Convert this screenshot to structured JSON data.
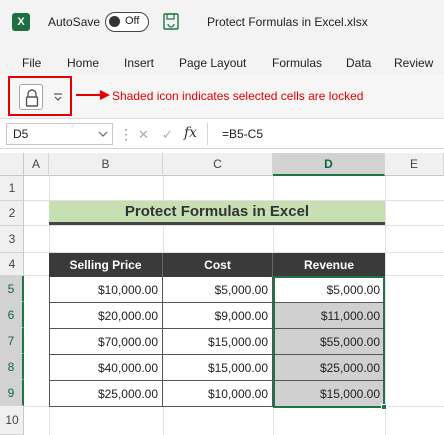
{
  "titlebar": {
    "app_icon_letter": "X",
    "autosave_label": "AutoSave",
    "autosave_state": "Off",
    "document_title": "Protect Formulas in Excel.xlsx"
  },
  "menu": {
    "items": [
      "File",
      "Home",
      "Insert",
      "Page Layout",
      "Formulas",
      "Data",
      "Review"
    ]
  },
  "ribbon": {
    "lock_icon": "lock-icon",
    "annotation": "Shaded icon indicates selected cells are locked",
    "annotation_color": "#e60000"
  },
  "formula_bar": {
    "name_box": "D5",
    "fx_label": "fx",
    "formula": "=B5-C5"
  },
  "grid": {
    "columns": [
      "A",
      "B",
      "C",
      "D",
      "E"
    ],
    "rows": [
      "1",
      "2",
      "3",
      "4",
      "5",
      "6",
      "7",
      "8",
      "9",
      "10"
    ],
    "active_column": "D",
    "accent_color": "#217346"
  },
  "sheet": {
    "title": "Protect Formulas in Excel",
    "title_fill": "#c6e0b4",
    "headers": [
      "Selling Price",
      "Cost",
      "Revenue"
    ],
    "rows": [
      [
        "$10,000.00",
        "$5,000.00",
        "$5,000.00"
      ],
      [
        "$20,000.00",
        "$9,000.00",
        "$11,000.00"
      ],
      [
        "$70,000.00",
        "$15,000.00",
        "$55,000.00"
      ],
      [
        "$40,000.00",
        "$15,000.00",
        "$25,000.00"
      ],
      [
        "$25,000.00",
        "$10,000.00",
        "$15,000.00"
      ]
    ]
  }
}
